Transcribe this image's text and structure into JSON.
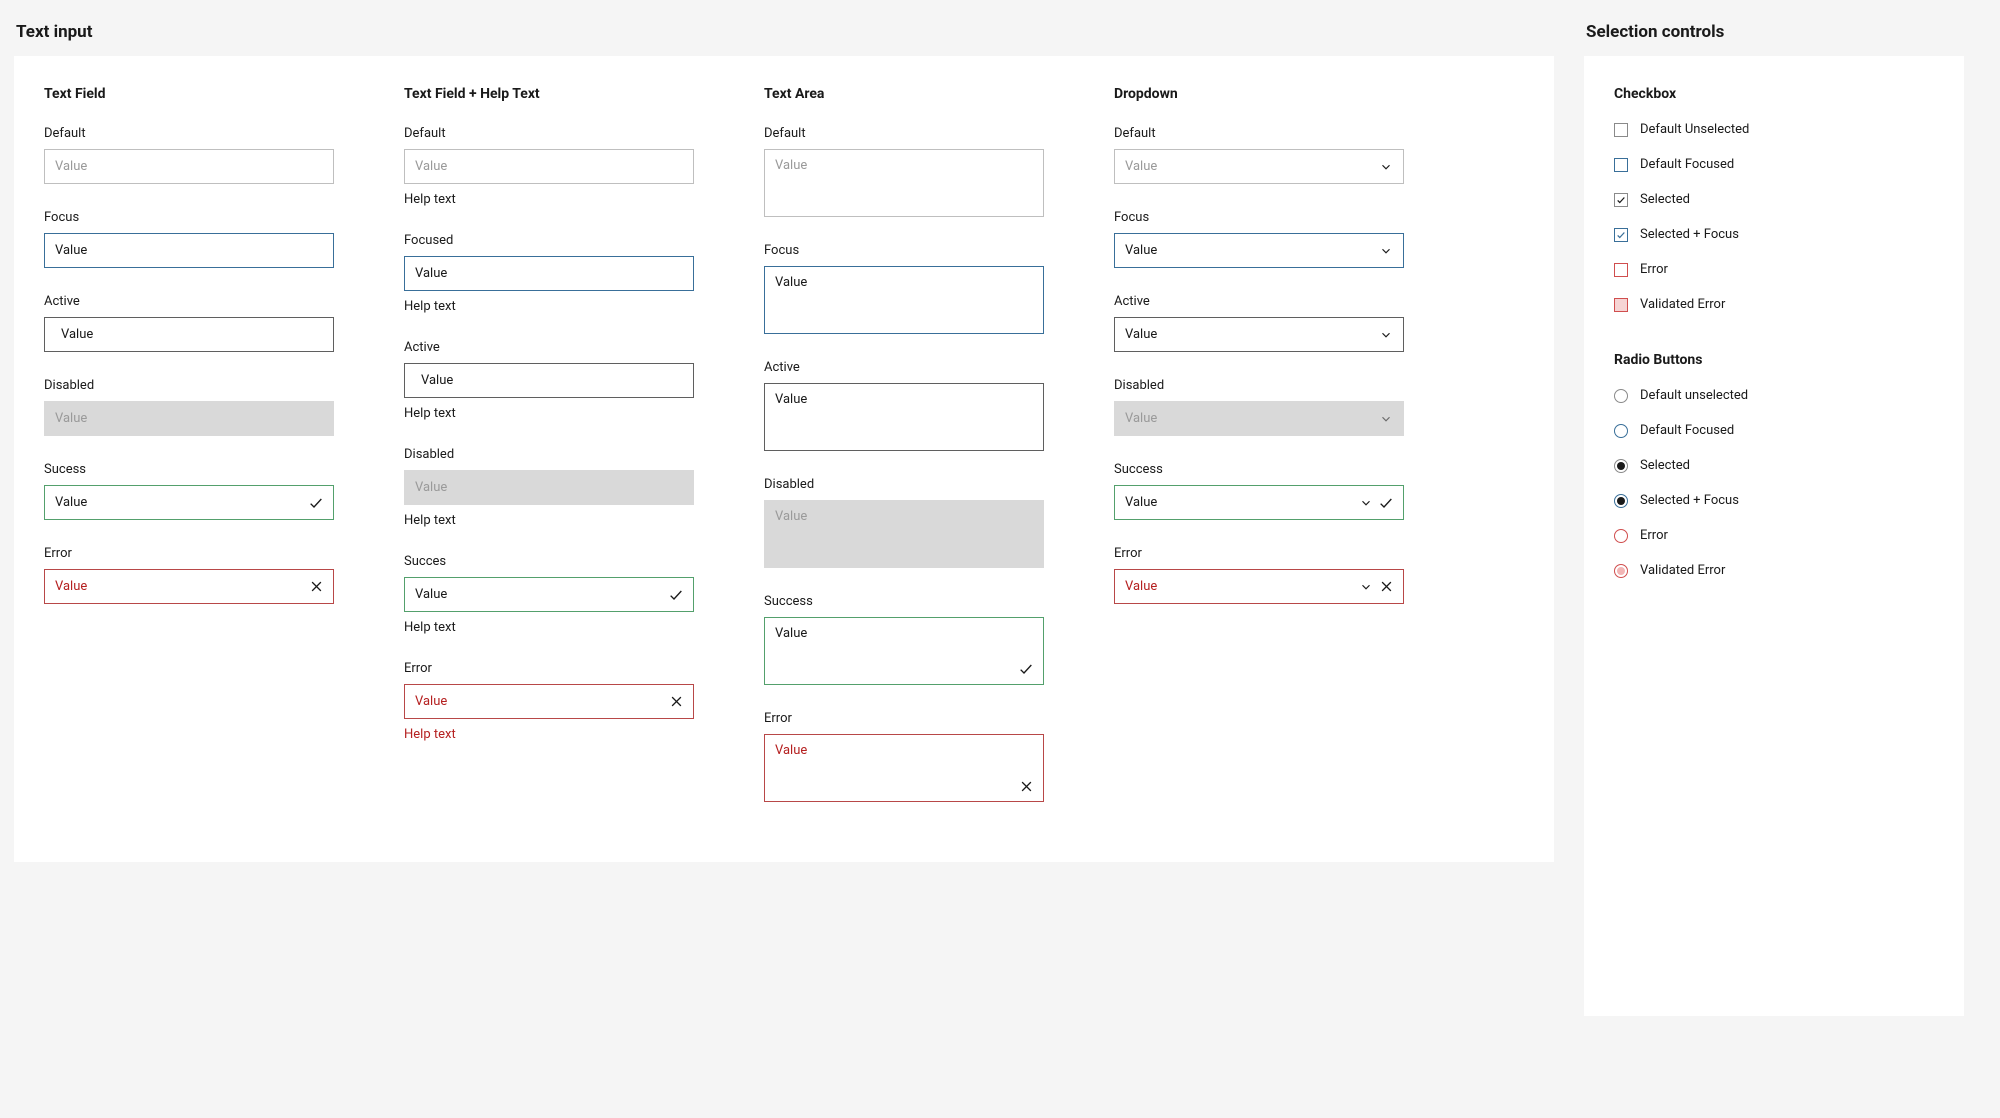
{
  "sections": {
    "text_input": "Text input",
    "selection_controls": "Selection controls"
  },
  "textfield": {
    "title": "Text Field",
    "states": [
      {
        "label": "Default",
        "placeholder": "Value"
      },
      {
        "label": "Focus",
        "value": "Value"
      },
      {
        "label": "Active",
        "value": "Value"
      },
      {
        "label": "Disabled",
        "value": "Value"
      },
      {
        "label": "Sucess",
        "value": "Value"
      },
      {
        "label": "Error",
        "value": "Value"
      }
    ]
  },
  "textfield_help": {
    "title": "Text Field + Help Text",
    "help": "Help text",
    "states": [
      {
        "label": "Default",
        "placeholder": "Value"
      },
      {
        "label": "Focused",
        "value": "Value"
      },
      {
        "label": "Active",
        "value": "Value"
      },
      {
        "label": "Disabled",
        "value": "Value"
      },
      {
        "label": "Succes",
        "value": "Value"
      },
      {
        "label": "Error",
        "value": "Value"
      }
    ]
  },
  "textarea": {
    "title": "Text Area",
    "states": [
      {
        "label": "Default",
        "placeholder": "Value"
      },
      {
        "label": "Focus",
        "value": "Value"
      },
      {
        "label": "Active",
        "value": "Value"
      },
      {
        "label": "Disabled",
        "value": "Value"
      },
      {
        "label": "Success",
        "value": "Value"
      },
      {
        "label": "Error",
        "value": "Value"
      }
    ]
  },
  "dropdown": {
    "title": "Dropdown",
    "states": [
      {
        "label": "Default",
        "placeholder": "Value"
      },
      {
        "label": "Focus",
        "value": "Value"
      },
      {
        "label": "Active",
        "value": "Value"
      },
      {
        "label": "Disabled",
        "value": "Value"
      },
      {
        "label": "Success",
        "value": "Value"
      },
      {
        "label": "Error",
        "value": "Value"
      }
    ]
  },
  "checkbox": {
    "title": "Checkbox",
    "items": [
      "Default Unselected",
      "Default Focused",
      "Selected",
      "Selected + Focus",
      "Error",
      "Validated Error"
    ]
  },
  "radio": {
    "title": "Radio Buttons",
    "items": [
      "Default unselected",
      "Default Focused",
      "Selected",
      "Selected + Focus",
      "Error",
      "Validated Error"
    ]
  }
}
